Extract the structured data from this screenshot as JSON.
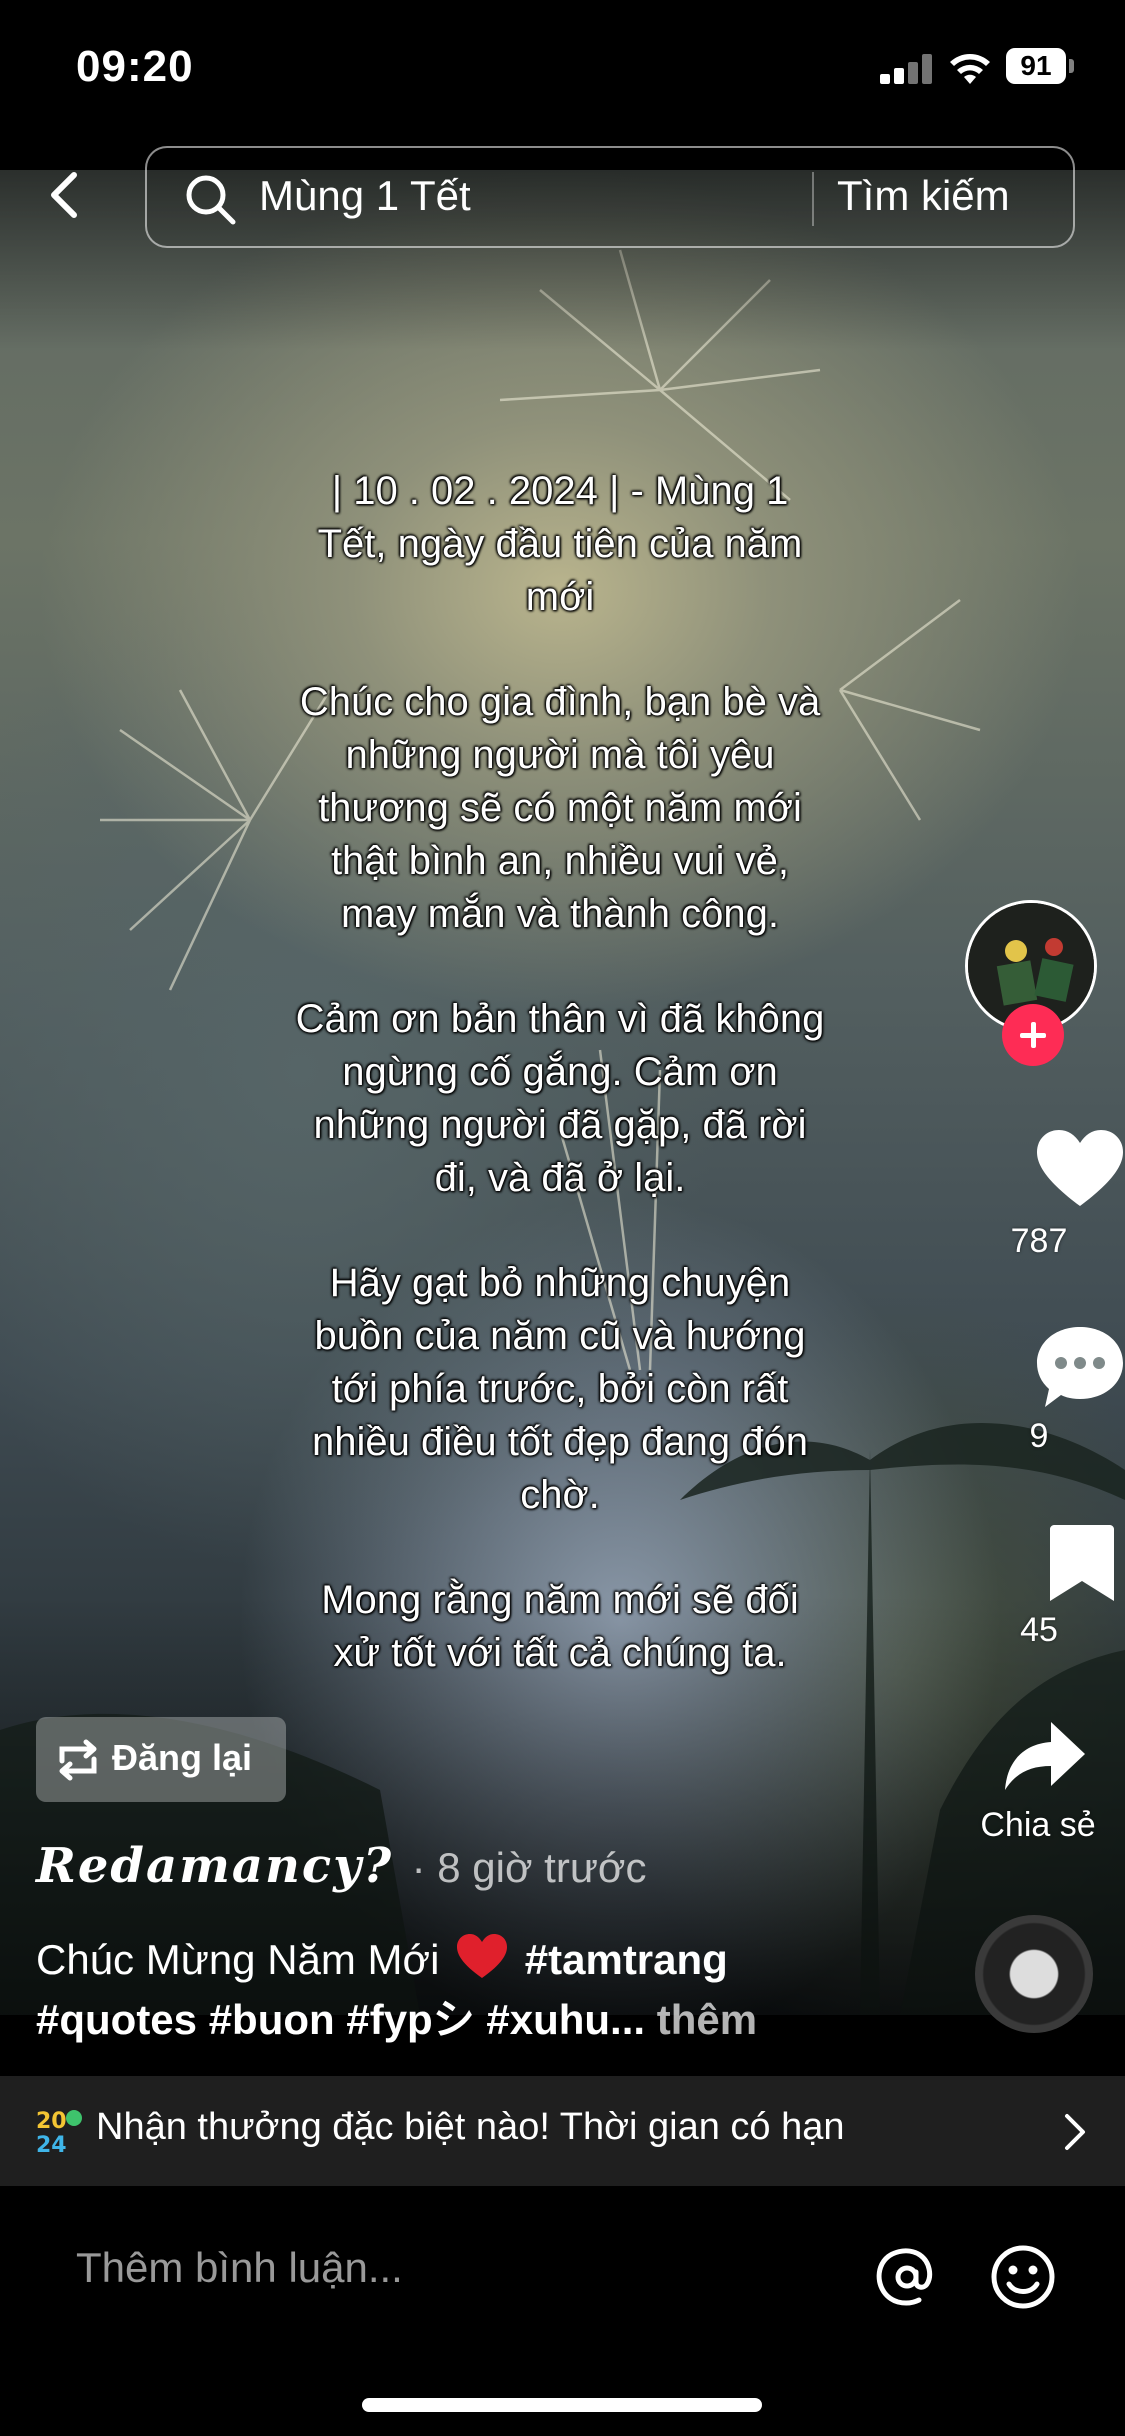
{
  "status_bar": {
    "time": "09:20",
    "battery": "91",
    "icons": [
      "cellular-signal-icon",
      "wifi-icon",
      "battery-icon"
    ]
  },
  "header": {
    "back_icon": "chevron-left-icon",
    "search_icon": "search-icon",
    "search_query": "Mùng 1 Tết",
    "search_button": "Tìm kiếm"
  },
  "overlay": {
    "paragraphs": [
      "| 10 . 02 . 2024 | - Mùng 1 Tết, ngày đầu tiên của năm mới",
      "Chúc cho gia đình, bạn bè và những người mà tôi yêu thương sẽ có một năm mới thật bình an, nhiều vui vẻ, may mắn và thành công.",
      "Cảm ơn bản thân vì đã không ngừng cố gắng. Cảm ơn những người đã gặp, đã rời đi, và đã ở lại.",
      "Hãy gạt bỏ những chuyện buồn của năm cũ và hướng tới phía trước, bởi còn rất nhiều điều tốt đẹp đang đón chờ.",
      "Mong rằng năm mới sẽ đối xử tốt với tất cả chúng ta."
    ]
  },
  "actions": {
    "likes": "787",
    "comments": "9",
    "saves": "45",
    "share_label": "Chia sẻ",
    "follow_color": "#fe2c55"
  },
  "post": {
    "repost_label": "Đăng lại",
    "author": "Redamancy?",
    "time_ago": "· 8 giờ trước",
    "caption_text": "Chúc Mừng Năm Mới",
    "caption_tags_line1": "#tamtrang",
    "caption_tags_line2": "#quotes #buon #fypシ #xuhu...",
    "more_label": "thêm"
  },
  "promo": {
    "text": "Nhận thưởng đặc biệt nào! Thời gian có hạn",
    "icon": "gift-2024-icon"
  },
  "comment": {
    "placeholder": "Thêm bình luận...",
    "icons": [
      "at-mention-icon",
      "emoji-icon"
    ]
  }
}
